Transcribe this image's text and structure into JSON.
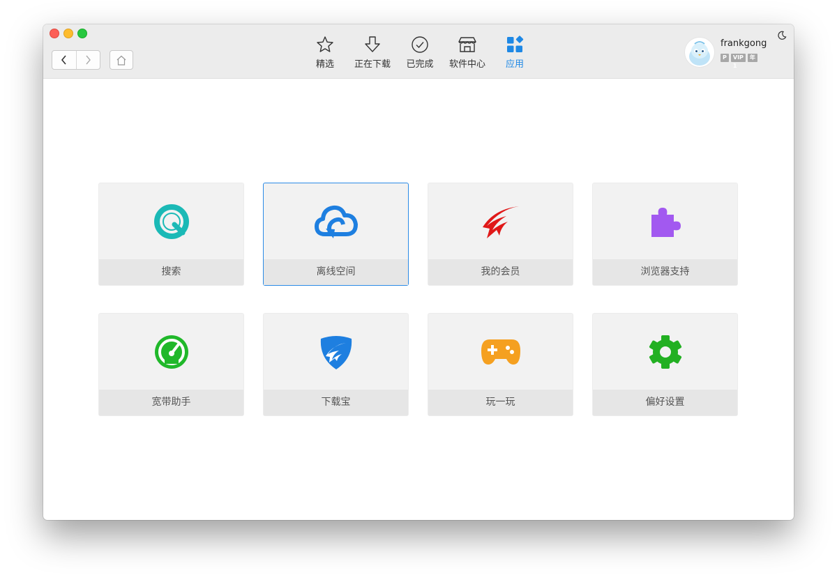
{
  "toolbar": {
    "items": [
      {
        "label": "精选",
        "icon": "star-icon"
      },
      {
        "label": "正在下载",
        "icon": "download-arrow-icon"
      },
      {
        "label": "已完成",
        "icon": "check-circle-icon"
      },
      {
        "label": "软件中心",
        "icon": "store-icon"
      },
      {
        "label": "应用",
        "icon": "apps-grid-icon",
        "active": true
      }
    ]
  },
  "user": {
    "name": "frankgong",
    "badges": [
      "P",
      "VIP 1",
      "年"
    ]
  },
  "apps": [
    {
      "label": "搜索",
      "icon": "search-icon",
      "color": "#1bb9b6"
    },
    {
      "label": "离线空间",
      "icon": "cloud-icon",
      "color": "#1e7fe0",
      "selected": true
    },
    {
      "label": "我的会员",
      "icon": "bird-logo-icon",
      "color": "#e01919"
    },
    {
      "label": "浏览器支持",
      "icon": "puzzle-icon",
      "color": "#a259f0"
    },
    {
      "label": "宽带助手",
      "icon": "speedometer-icon",
      "color": "#20b82a"
    },
    {
      "label": "下载宝",
      "icon": "shield-icon",
      "color": "#1e7fe0"
    },
    {
      "label": "玩一玩",
      "icon": "gamepad-icon",
      "color": "#f5a020"
    },
    {
      "label": "偏好设置",
      "icon": "gear-icon",
      "color": "#22b022"
    }
  ],
  "colors": {
    "accent": "#1e88e5",
    "selected_border": "#2a8ae6"
  }
}
